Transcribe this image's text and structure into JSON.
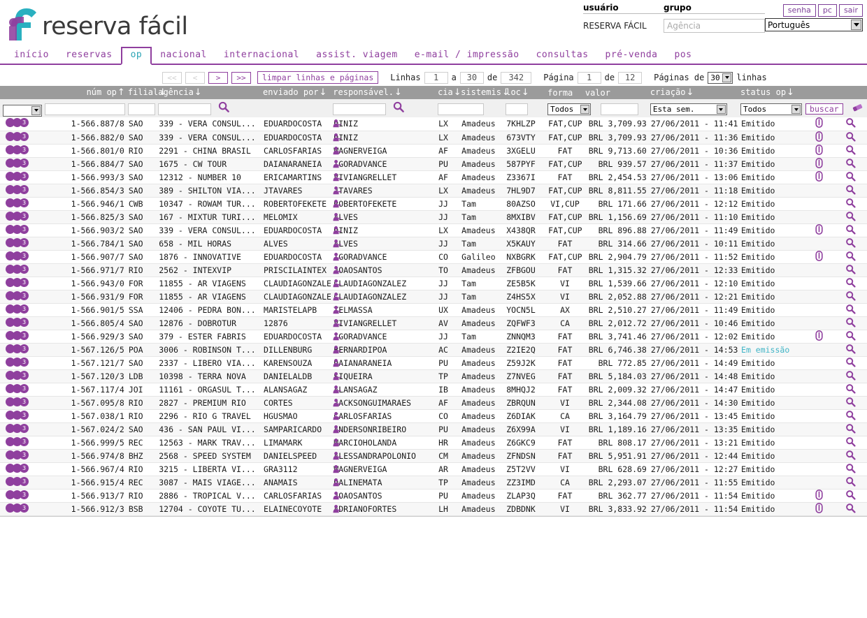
{
  "brand": {
    "name": "reserva fácil"
  },
  "account": {
    "usuario_label": "usuário",
    "grupo_label": "grupo",
    "usuario_value": "RESERVA FÁCIL",
    "agencia_placeholder": "Agência",
    "agencia_value": "",
    "language": "Português",
    "buttons": [
      "senha",
      "pc",
      "sair"
    ]
  },
  "nav": {
    "items": [
      {
        "label": "início",
        "active": false
      },
      {
        "label": "reservas",
        "active": false
      },
      {
        "label": "op",
        "active": true
      },
      {
        "label": "nacional",
        "active": false
      },
      {
        "label": "internacional",
        "active": false
      },
      {
        "label": "assist. viagem",
        "active": false
      },
      {
        "label": "e-mail / impressão",
        "active": false
      },
      {
        "label": "consultas",
        "active": false
      },
      {
        "label": "pré-venda",
        "active": false
      },
      {
        "label": "pos",
        "active": false
      }
    ]
  },
  "toolbar": {
    "first_label": "<<",
    "prev_label": "<",
    "next_label": ">",
    "last_label": ">>",
    "clear_label": "limpar linhas e páginas",
    "linhas_label": "Linhas",
    "linha_de": "1",
    "a_label": "a",
    "linha_ate": "30",
    "de_label": "de",
    "linhas_total": "342",
    "pagina_label": "Página",
    "pagina_atual": "1",
    "de_label2": "de",
    "pagina_total": "12",
    "paginas_de_label": "Páginas de",
    "page_size": "30",
    "linhas_suffix": "linhas"
  },
  "columns": {
    "num_op": "núm op",
    "filial": "filial",
    "agencia": "agência",
    "enviado_por": "enviado por",
    "responsavel": "responsável.",
    "cia": "cia",
    "sistemis": "sistemis",
    "loc": "loc",
    "forma": "forma",
    "valor": "valor",
    "criacao": "criação",
    "status_op": "status op"
  },
  "filters": {
    "num_op": "",
    "filial": "",
    "agencia": "",
    "enviado_por": "",
    "responsavel": "",
    "cia": "",
    "sistemis": "Todos",
    "loc": "",
    "criacao": "Esta sem.",
    "status": "Todos",
    "buscar_label": "buscar"
  },
  "rows": [
    {
      "beads": "3",
      "num": "1-566.887/8",
      "filial": "SAO",
      "agencia": "339 - VERA CONSUL...",
      "enviado": "EDUARDOCOSTA",
      "resp": "DINIZ",
      "cia": "LX",
      "sis": "Amadeus",
      "loc": "7KHLZP",
      "forma": "FAT,CUP",
      "valor": "BRL 3,709.93",
      "criacao": "27/06/2011 - 11:41",
      "status": "Emitido",
      "clip": true
    },
    {
      "beads": "3",
      "num": "1-566.882/0",
      "filial": "SAO",
      "agencia": "339 - VERA CONSUL...",
      "enviado": "EDUARDOCOSTA",
      "resp": "DINIZ",
      "cia": "LX",
      "sis": "Amadeus",
      "loc": "673VTY",
      "forma": "FAT,CUP",
      "valor": "BRL 3,709.93",
      "criacao": "27/06/2011 - 11:36",
      "status": "Emitido",
      "clip": true
    },
    {
      "beads": "3",
      "num": "1-566.801/0",
      "filial": "RIO",
      "agencia": "2291 - CHINA BRASIL",
      "enviado": "CARLOSFARIAS",
      "resp": "WAGNERVEIGA",
      "cia": "AF",
      "sis": "Amadeus",
      "loc": "3XGELU",
      "forma": "FAT",
      "valor": "BRL 9,713.60",
      "criacao": "27/06/2011 - 10:36",
      "status": "Emitido",
      "clip": true
    },
    {
      "beads": "3",
      "num": "1-566.884/7",
      "filial": "SAO",
      "agencia": "1675 - CW TOUR",
      "enviado": "DAIANARANEIA",
      "resp": "IGORADVANCE",
      "cia": "PU",
      "sis": "Amadeus",
      "loc": "587PYF",
      "forma": "FAT,CUP",
      "valor": "BRL 939.57",
      "criacao": "27/06/2011 - 11:37",
      "status": "Emitido",
      "clip": true
    },
    {
      "beads": "3",
      "num": "1-566.993/3",
      "filial": "SAO",
      "agencia": "12312 - NUMBER 10",
      "enviado": "ERICAMARTINS",
      "resp": "VIVIANGRELLET",
      "cia": "AF",
      "sis": "Amadeus",
      "loc": "Z3367I",
      "forma": "FAT",
      "valor": "BRL 2,454.53",
      "criacao": "27/06/2011 - 13:06",
      "status": "Emitido",
      "clip": true
    },
    {
      "beads": "3",
      "num": "1-566.854/3",
      "filial": "SAO",
      "agencia": "389 - SHILTON VIA...",
      "enviado": "JTAVARES",
      "resp": "JTAVARES",
      "cia": "LX",
      "sis": "Amadeus",
      "loc": "7HL9D7",
      "forma": "FAT,CUP",
      "valor": "BRL 8,811.55",
      "criacao": "27/06/2011 - 11:18",
      "status": "Emitido",
      "clip": false
    },
    {
      "beads": "3",
      "num": "1-566.946/1",
      "filial": "CWB",
      "agencia": "10347 - ROWAM TUR...",
      "enviado": "ROBERTOFEKETE",
      "resp": "ROBERTOFEKETE",
      "cia": "JJ",
      "sis": "Tam",
      "loc": "80AZSO",
      "forma": "VI,CUP",
      "valor": "BRL 171.66",
      "criacao": "27/06/2011 - 12:12",
      "status": "Emitido",
      "clip": false
    },
    {
      "beads": "3",
      "num": "1-566.825/3",
      "filial": "SAO",
      "agencia": "167 - MIXTUR TURI...",
      "enviado": "MELOMIX",
      "resp": "ALVES",
      "cia": "JJ",
      "sis": "Tam",
      "loc": "8MXIBV",
      "forma": "FAT,CUP",
      "valor": "BRL 1,156.69",
      "criacao": "27/06/2011 - 11:10",
      "status": "Emitido",
      "clip": false
    },
    {
      "beads": "3",
      "num": "1-566.903/2",
      "filial": "SAO",
      "agencia": "339 - VERA CONSUL...",
      "enviado": "EDUARDOCOSTA",
      "resp": "DINIZ",
      "cia": "LX",
      "sis": "Amadeus",
      "loc": "X438QR",
      "forma": "FAT,CUP",
      "valor": "BRL 896.88",
      "criacao": "27/06/2011 - 11:49",
      "status": "Emitido",
      "clip": true
    },
    {
      "beads": "3",
      "num": "1-566.784/1",
      "filial": "SAO",
      "agencia": "658 - MIL HORAS",
      "enviado": "ALVES",
      "resp": "ALVES",
      "cia": "JJ",
      "sis": "Tam",
      "loc": "X5KAUY",
      "forma": "FAT",
      "valor": "BRL 314.66",
      "criacao": "27/06/2011 - 10:11",
      "status": "Emitido",
      "clip": false
    },
    {
      "beads": "3",
      "num": "1-566.907/7",
      "filial": "SAO",
      "agencia": "1876 - INNOVATIVE",
      "enviado": "EDUARDOCOSTA",
      "resp": "IGORADVANCE",
      "cia": "CO",
      "sis": "Galileo",
      "loc": "NXBGRK",
      "forma": "FAT,CUP",
      "valor": "BRL 2,904.79",
      "criacao": "27/06/2011 - 11:52",
      "status": "Emitido",
      "clip": true
    },
    {
      "beads": "3",
      "num": "1-566.971/7",
      "filial": "RIO",
      "agencia": "2562 - INTEXVIP",
      "enviado": "PRISCILAINTEX",
      "resp": "JOAOSANTOS",
      "cia": "TO",
      "sis": "Amadeus",
      "loc": "ZFBGOU",
      "forma": "FAT",
      "valor": "BRL 1,315.32",
      "criacao": "27/06/2011 - 12:33",
      "status": "Emitido",
      "clip": false
    },
    {
      "beads": "3",
      "num": "1-566.943/0",
      "filial": "FOR",
      "agencia": "11855 - AR VIAGENS",
      "enviado": "CLAUDIAGONZALEZ",
      "resp": "CLAUDIAGONZALEZ",
      "cia": "JJ",
      "sis": "Tam",
      "loc": "ZE5B5K",
      "forma": "VI",
      "valor": "BRL 1,539.66",
      "criacao": "27/06/2011 - 12:10",
      "status": "Emitido",
      "clip": false
    },
    {
      "beads": "3",
      "num": "1-566.931/9",
      "filial": "FOR",
      "agencia": "11855 - AR VIAGENS",
      "enviado": "CLAUDIAGONZALEZ",
      "resp": "CLAUDIAGONZALEZ",
      "cia": "JJ",
      "sis": "Tam",
      "loc": "Z4HS5X",
      "forma": "VI",
      "valor": "BRL 2,052.88",
      "criacao": "27/06/2011 - 12:21",
      "status": "Emitido",
      "clip": false
    },
    {
      "beads": "3",
      "num": "1-566.901/5",
      "filial": "SSA",
      "agencia": "12406 - PEDRA BON...",
      "enviado": "MARISTELAPB",
      "resp": "TELMASSA",
      "cia": "UX",
      "sis": "Amadeus",
      "loc": "YOCN5L",
      "forma": "AX",
      "valor": "BRL 2,510.27",
      "criacao": "27/06/2011 - 11:49",
      "status": "Emitido",
      "clip": false
    },
    {
      "beads": "3",
      "num": "1-566.805/4",
      "filial": "SAO",
      "agencia": "12876 - DOBROTUR",
      "enviado": "12876",
      "resp": "VIVIANGRELLET",
      "cia": "AV",
      "sis": "Amadeus",
      "loc": "ZQFWF3",
      "forma": "CA",
      "valor": "BRL 2,012.72",
      "criacao": "27/06/2011 - 10:46",
      "status": "Emitido",
      "clip": false
    },
    {
      "beads": "3",
      "num": "1-566.929/3",
      "filial": "SAO",
      "agencia": "379 - ESTER FABRIS",
      "enviado": "EDUARDOCOSTA",
      "resp": "IGORADVANCE",
      "cia": "JJ",
      "sis": "Tam",
      "loc": "ZNNQM3",
      "forma": "FAT",
      "valor": "BRL 3,741.46",
      "criacao": "27/06/2011 - 12:02",
      "status": "Emitido",
      "clip": true
    },
    {
      "beads": "3",
      "num": "1-567.126/5",
      "filial": "POA",
      "agencia": "3006 - ROBINSON T...",
      "enviado": "DILLENBURG",
      "resp": "BERNARDIPOA",
      "cia": "AC",
      "sis": "Amadeus",
      "loc": "Z2IE2Q",
      "forma": "FAT",
      "valor": "BRL 6,746.38",
      "criacao": "27/06/2011 - 14:53",
      "status": "Em emissão",
      "clip": false
    },
    {
      "beads": "3",
      "num": "1-567.121/7",
      "filial": "SAO",
      "agencia": "2337 - LIBERO VIA...",
      "enviado": "KARENSOUZA",
      "resp": "DAIANARANEIA",
      "cia": "PU",
      "sis": "Amadeus",
      "loc": "Z59J2K",
      "forma": "FAT",
      "valor": "BRL 772.85",
      "criacao": "27/06/2011 - 14:49",
      "status": "Emitido",
      "clip": false
    },
    {
      "beads": "3",
      "num": "1-567.120/3",
      "filial": "LDB",
      "agencia": "10398 - TERRA NOVA",
      "enviado": "DANIELALDB",
      "resp": "SIQUEIRA",
      "cia": "TP",
      "sis": "Amadeus",
      "loc": "Z7NVEG",
      "forma": "FAT",
      "valor": "BRL 5,184.03",
      "criacao": "27/06/2011 - 14:48",
      "status": "Emitido",
      "clip": false
    },
    {
      "beads": "3",
      "num": "1-567.117/4",
      "filial": "JOI",
      "agencia": "11161 - ORGASUL T...",
      "enviado": "ALANSAGAZ",
      "resp": "ALANSAGAZ",
      "cia": "IB",
      "sis": "Amadeus",
      "loc": "8MHQJ2",
      "forma": "FAT",
      "valor": "BRL 2,009.32",
      "criacao": "27/06/2011 - 14:47",
      "status": "Emitido",
      "clip": false
    },
    {
      "beads": "3",
      "num": "1-567.095/8",
      "filial": "RIO",
      "agencia": "2827 - PREMIUM RIO",
      "enviado": "CORTES",
      "resp": "JACKSONGUIMARAES",
      "cia": "AF",
      "sis": "Amadeus",
      "loc": "ZBRQUN",
      "forma": "VI",
      "valor": "BRL 2,344.08",
      "criacao": "27/06/2011 - 14:30",
      "status": "Emitido",
      "clip": false
    },
    {
      "beads": "3",
      "num": "1-567.038/1",
      "filial": "RIO",
      "agencia": "2296 - RIO G TRAVEL",
      "enviado": "HGUSMAO",
      "resp": "CARLOSFARIAS",
      "cia": "CO",
      "sis": "Amadeus",
      "loc": "Z6DIAK",
      "forma": "CA",
      "valor": "BRL 3,164.79",
      "criacao": "27/06/2011 - 13:45",
      "status": "Emitido",
      "clip": false
    },
    {
      "beads": "3",
      "num": "1-567.024/2",
      "filial": "SAO",
      "agencia": "436 - SAN PAUL VI...",
      "enviado": "SAMPARICARDO",
      "resp": "ANDERSONRIBEIRO",
      "cia": "PU",
      "sis": "Amadeus",
      "loc": "Z6X99A",
      "forma": "VI",
      "valor": "BRL 1,189.16",
      "criacao": "27/06/2011 - 13:35",
      "status": "Emitido",
      "clip": false
    },
    {
      "beads": "3",
      "num": "1-566.999/5",
      "filial": "REC",
      "agencia": "12563 - MARK TRAV...",
      "enviado": "LIMAMARK",
      "resp": "MARCIOHOLANDA",
      "cia": "HR",
      "sis": "Amadeus",
      "loc": "Z6GKC9",
      "forma": "FAT",
      "valor": "BRL 808.17",
      "criacao": "27/06/2011 - 13:21",
      "status": "Emitido",
      "clip": false
    },
    {
      "beads": "3",
      "num": "1-566.974/8",
      "filial": "BHZ",
      "agencia": "2568 - SPEED SYSTEM",
      "enviado": "DANIELSPEED",
      "resp": "ALESSANDRAPOLONIO",
      "cia": "CM",
      "sis": "Amadeus",
      "loc": "ZFNDSN",
      "forma": "FAT",
      "valor": "BRL 5,951.91",
      "criacao": "27/06/2011 - 12:44",
      "status": "Emitido",
      "clip": false
    },
    {
      "beads": "3",
      "num": "1-566.967/4",
      "filial": "RIO",
      "agencia": "3215 - LIBERTA VI...",
      "enviado": "GRA3112",
      "resp": "WAGNERVEIGA",
      "cia": "AR",
      "sis": "Amadeus",
      "loc": "Z5T2VV",
      "forma": "VI",
      "valor": "BRL 628.69",
      "criacao": "27/06/2011 - 12:27",
      "status": "Emitido",
      "clip": false
    },
    {
      "beads": "3",
      "num": "1-566.915/4",
      "filial": "REC",
      "agencia": "3087 - MAIS VIAGE...",
      "enviado": "ANAMAIS",
      "resp": "DALINEMATA",
      "cia": "TP",
      "sis": "Amadeus",
      "loc": "ZZ3IMD",
      "forma": "CA",
      "valor": "BRL 2,293.07",
      "criacao": "27/06/2011 - 11:55",
      "status": "Emitido",
      "clip": false
    },
    {
      "beads": "3",
      "num": "1-566.913/7",
      "filial": "RIO",
      "agencia": "2886 - TROPICAL V...",
      "enviado": "CARLOSFARIAS",
      "resp": "JOAOSANTOS",
      "cia": "PU",
      "sis": "Amadeus",
      "loc": "ZLAP3Q",
      "forma": "FAT",
      "valor": "BRL 362.77",
      "criacao": "27/06/2011 - 11:54",
      "status": "Emitido",
      "clip": true
    },
    {
      "beads": "3",
      "num": "1-566.912/3",
      "filial": "BSB",
      "agencia": "12704 - COYOTE TU...",
      "enviado": "ELAINECOYOTE",
      "resp": "ADRIANOFORTES",
      "cia": "LH",
      "sis": "Amadeus",
      "loc": "ZDBDNK",
      "forma": "VI",
      "valor": "BRL 3,833.92",
      "criacao": "27/06/2011 - 11:54",
      "status": "Emitido",
      "clip": true
    }
  ],
  "colors": {
    "brand_purple": "#8f3f9e",
    "teal": "#2aa4b5",
    "header_gray": "#9b9b9b",
    "status_green": "#2f7a4f",
    "status_teal": "#3fb4c6"
  }
}
